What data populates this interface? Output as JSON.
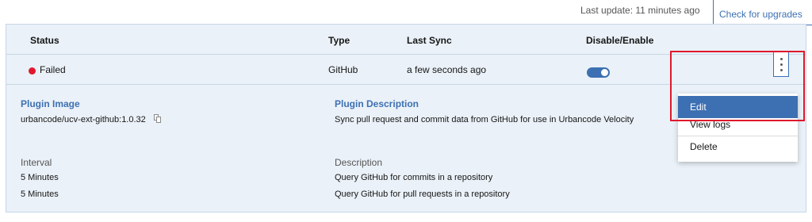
{
  "top": {
    "last_update": "Last update: 11 minutes ago",
    "upgrade_label": "Check for upgrades"
  },
  "table": {
    "columns": {
      "status": "Status",
      "type": "Type",
      "last_sync": "Last Sync",
      "disable_enable": "Disable/Enable"
    },
    "row": {
      "status": "Failed",
      "type": "GitHub",
      "last_sync": "a few seconds ago",
      "enabled": true
    }
  },
  "details": {
    "plugin_image_label": "Plugin Image",
    "plugin_image_value": "urbancode/ucv-ext-github:1.0.32",
    "plugin_description_label": "Plugin Description",
    "plugin_description_value": "Sync pull request and commit data from GitHub for use in Urbancode Velocity",
    "interval_label": "Interval",
    "description_label": "Description",
    "jobs": [
      {
        "interval": "5 Minutes",
        "description": "Query GitHub for commits in a repository"
      },
      {
        "interval": "5 Minutes",
        "description": "Query GitHub for pull requests in a repository"
      }
    ]
  },
  "menu": {
    "items": [
      "Edit",
      "View logs",
      "Delete"
    ],
    "active_index": 0
  },
  "colors": {
    "accent": "#3d70b2",
    "failed": "#e0182d",
    "highlight": "#e0182d",
    "row_background": "#eaf1f8"
  }
}
